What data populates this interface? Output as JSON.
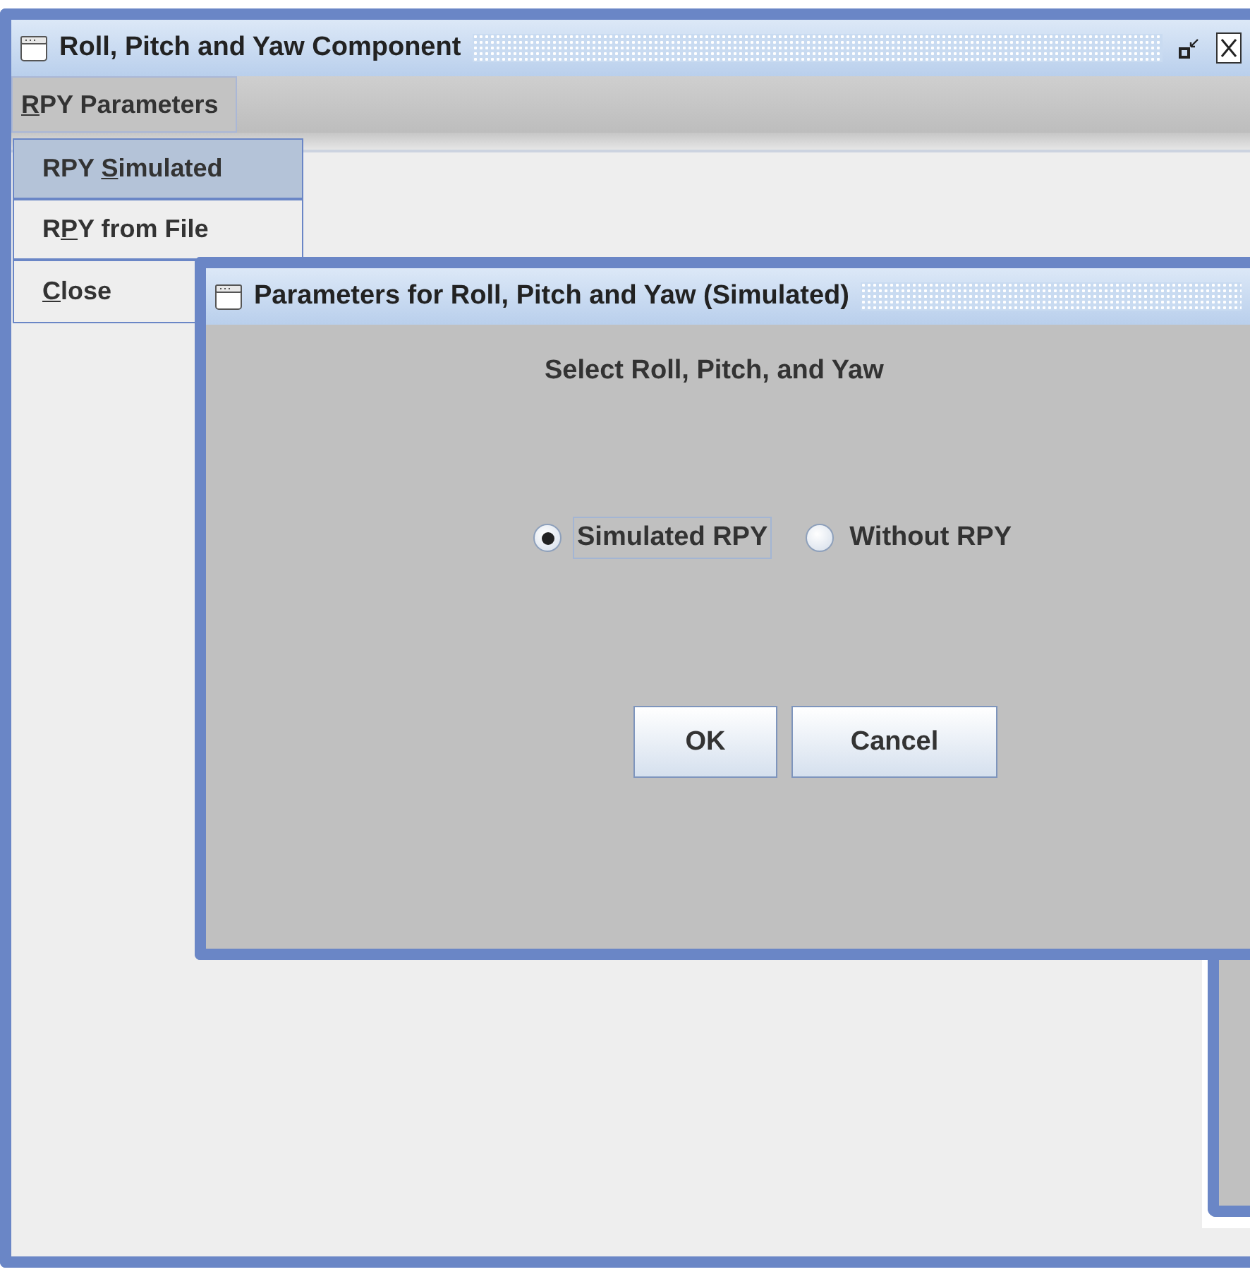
{
  "window": {
    "title": "Roll, Pitch and Yaw Component",
    "controls": [
      {
        "kind": "restore"
      },
      {
        "kind": "close"
      }
    ]
  },
  "menu_bar": {
    "menus": [
      {
        "mnemonic": "R",
        "after": "PY Parameters",
        "selected": true
      }
    ]
  },
  "menu_popup": {
    "items": [
      {
        "before": "RPY ",
        "mnemonic": "S",
        "after": "imulated",
        "selected": true
      },
      {
        "before": "R",
        "mnemonic": "P",
        "after": "Y from File",
        "selected": false
      },
      {
        "mnemonic": "C",
        "after": "lose",
        "selected": false
      }
    ]
  },
  "dialog": {
    "title": "Parameters for Roll, Pitch and Yaw (Simulated)",
    "heading": "Select Roll, Pitch, and Yaw",
    "options": [
      {
        "label": "Simulated RPY",
        "selected": true
      },
      {
        "label": "Without RPY",
        "selected": false
      }
    ],
    "buttons": [
      "OK",
      "Cancel"
    ]
  },
  "background_window": {
    "active": false
  }
}
